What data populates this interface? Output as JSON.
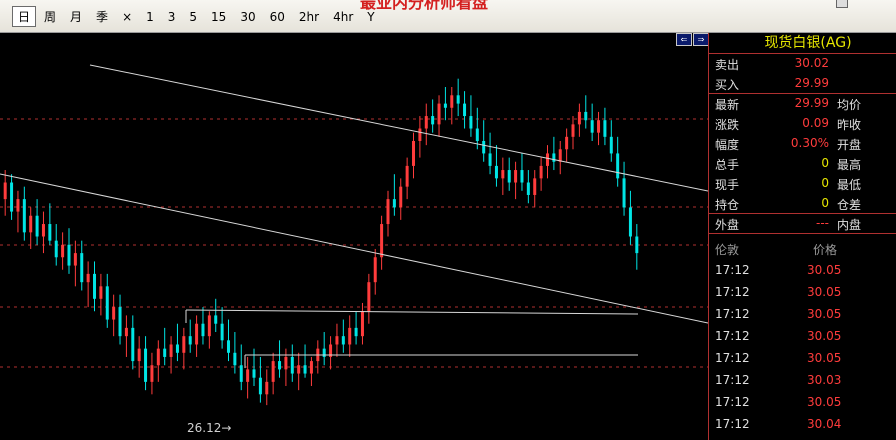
{
  "toolbar": {
    "periods": [
      "日",
      "周",
      "月",
      "季",
      "×",
      "1",
      "3",
      "5",
      "15",
      "30",
      "60",
      "2hr",
      "4hr",
      "Y"
    ],
    "active_index": 0,
    "banner": "最业内分析师看盘"
  },
  "chart": {
    "low_label": "26.12→"
  },
  "panel": {
    "title": "现货白银(AG)",
    "quote_rows": [
      {
        "label": "卖出",
        "value": "30.02",
        "value_color": "red",
        "label2": ""
      },
      {
        "label": "买入",
        "value": "29.99",
        "value_color": "red",
        "label2": ""
      },
      {
        "label": "最新",
        "value": "29.99",
        "value_color": "red",
        "label2": "均价"
      },
      {
        "label": "涨跌",
        "value": "0.09",
        "value_color": "red",
        "label2": "昨收"
      },
      {
        "label": "幅度",
        "value": "0.30%",
        "value_color": "red",
        "label2": "开盘"
      },
      {
        "label": "总手",
        "value": "0",
        "value_color": "yellow",
        "label2": "最高"
      },
      {
        "label": "现手",
        "value": "0",
        "value_color": "yellow",
        "label2": "最低"
      },
      {
        "label": "持仓",
        "value": "0",
        "value_color": "yellow",
        "label2": "仓差"
      },
      {
        "label": "外盘",
        "value": "---",
        "value_color": "red",
        "label2": "内盘"
      }
    ],
    "ticks_header": {
      "col1": "伦敦",
      "col2": "价格"
    },
    "ticks": [
      {
        "time": "17:12",
        "price": "30.05"
      },
      {
        "time": "17:12",
        "price": "30.05"
      },
      {
        "time": "17:12",
        "price": "30.05"
      },
      {
        "time": "17:12",
        "price": "30.05"
      },
      {
        "time": "17:12",
        "price": "30.05"
      },
      {
        "time": "17:12",
        "price": "30.03"
      },
      {
        "time": "17:12",
        "price": "30.05"
      },
      {
        "time": "17:12",
        "price": "30.04"
      }
    ]
  },
  "chart_data": {
    "type": "candlestick",
    "price_low_marker": 26.12,
    "colors": {
      "up": "#ff3c3c",
      "down": "#00e5e5",
      "background": "#000000",
      "grid": "#b03030"
    },
    "grid": "dashed horizontal",
    "series": [
      {
        "ohlc": [
          [
            28.6,
            28.95,
            28.4,
            28.8
          ],
          [
            28.8,
            28.9,
            28.35,
            28.45
          ],
          [
            28.45,
            28.7,
            28.2,
            28.6
          ],
          [
            28.6,
            28.75,
            28.1,
            28.2
          ],
          [
            28.2,
            28.5,
            28.0,
            28.4
          ],
          [
            28.4,
            28.6,
            28.05,
            28.15
          ],
          [
            28.15,
            28.45,
            27.95,
            28.3
          ],
          [
            28.3,
            28.55,
            28.05,
            28.1
          ],
          [
            28.1,
            28.3,
            27.8,
            27.9
          ],
          [
            27.9,
            28.2,
            27.75,
            28.05
          ],
          [
            28.05,
            28.25,
            27.7,
            27.8
          ],
          [
            27.8,
            28.1,
            27.55,
            27.95
          ],
          [
            27.95,
            28.1,
            27.5,
            27.6
          ],
          [
            27.6,
            27.85,
            27.3,
            27.7
          ],
          [
            27.7,
            27.85,
            27.25,
            27.4
          ],
          [
            27.4,
            27.7,
            27.2,
            27.55
          ],
          [
            27.55,
            27.7,
            27.05,
            27.15
          ],
          [
            27.15,
            27.45,
            26.95,
            27.3
          ],
          [
            27.3,
            27.45,
            26.85,
            26.95
          ],
          [
            26.95,
            27.2,
            26.7,
            27.05
          ],
          [
            27.05,
            27.2,
            26.55,
            26.65
          ],
          [
            26.65,
            26.95,
            26.45,
            26.8
          ],
          [
            26.8,
            26.95,
            26.3,
            26.4
          ],
          [
            26.4,
            26.75,
            26.25,
            26.6
          ],
          [
            26.6,
            26.9,
            26.4,
            26.8
          ],
          [
            26.8,
            27.05,
            26.6,
            26.7
          ],
          [
            26.7,
            26.95,
            26.5,
            26.85
          ],
          [
            26.85,
            27.1,
            26.65,
            26.75
          ],
          [
            26.75,
            27.05,
            26.55,
            26.95
          ],
          [
            26.95,
            27.15,
            26.75,
            26.85
          ],
          [
            26.85,
            27.2,
            26.7,
            27.1
          ],
          [
            27.1,
            27.3,
            26.85,
            26.95
          ],
          [
            26.95,
            27.25,
            26.8,
            27.2
          ],
          [
            27.2,
            27.4,
            27.0,
            27.1
          ],
          [
            27.1,
            27.3,
            26.8,
            26.9
          ],
          [
            26.9,
            27.15,
            26.65,
            26.75
          ],
          [
            26.75,
            27.0,
            26.5,
            26.6
          ],
          [
            26.6,
            26.85,
            26.3,
            26.4
          ],
          [
            26.4,
            26.7,
            26.2,
            26.55
          ],
          [
            26.55,
            26.8,
            26.35,
            26.45
          ],
          [
            26.45,
            26.7,
            26.15,
            26.25
          ],
          [
            26.25,
            26.55,
            26.12,
            26.4
          ],
          [
            26.4,
            26.75,
            26.25,
            26.65
          ],
          [
            26.65,
            26.9,
            26.45,
            26.55
          ],
          [
            26.55,
            26.8,
            26.35,
            26.7
          ],
          [
            26.7,
            26.85,
            26.4,
            26.5
          ],
          [
            26.5,
            26.75,
            26.3,
            26.6
          ],
          [
            26.6,
            26.85,
            26.45,
            26.5
          ],
          [
            26.5,
            26.7,
            26.35,
            26.65
          ],
          [
            26.65,
            26.9,
            26.5,
            26.8
          ],
          [
            26.8,
            27.0,
            26.6,
            26.7
          ],
          [
            26.7,
            26.95,
            26.55,
            26.85
          ],
          [
            26.85,
            27.1,
            26.7,
            26.95
          ],
          [
            26.95,
            27.15,
            26.75,
            26.85
          ],
          [
            26.85,
            27.2,
            26.7,
            27.05
          ],
          [
            27.05,
            27.25,
            26.85,
            26.95
          ],
          [
            26.95,
            27.35,
            26.85,
            27.25
          ],
          [
            27.25,
            27.7,
            27.1,
            27.6
          ],
          [
            27.6,
            28.0,
            27.45,
            27.9
          ],
          [
            27.9,
            28.4,
            27.75,
            28.3
          ],
          [
            28.3,
            28.7,
            28.15,
            28.6
          ],
          [
            28.6,
            28.9,
            28.4,
            28.5
          ],
          [
            28.5,
            28.85,
            28.35,
            28.75
          ],
          [
            28.75,
            29.1,
            28.6,
            29.0
          ],
          [
            29.0,
            29.4,
            28.85,
            29.3
          ],
          [
            29.3,
            29.6,
            29.1,
            29.45
          ],
          [
            29.45,
            29.75,
            29.25,
            29.6
          ],
          [
            29.6,
            29.8,
            29.4,
            29.5
          ],
          [
            29.5,
            29.85,
            29.35,
            29.75
          ],
          [
            29.75,
            29.95,
            29.55,
            29.7
          ],
          [
            29.7,
            29.95,
            29.5,
            29.85
          ],
          [
            29.85,
            30.05,
            29.6,
            29.75
          ],
          [
            29.75,
            29.9,
            29.45,
            29.6
          ],
          [
            29.6,
            29.85,
            29.35,
            29.45
          ],
          [
            29.45,
            29.7,
            29.2,
            29.3
          ],
          [
            29.3,
            29.55,
            29.05,
            29.15
          ],
          [
            29.15,
            29.4,
            28.9,
            29.0
          ],
          [
            29.0,
            29.25,
            28.75,
            28.85
          ],
          [
            28.85,
            29.1,
            28.65,
            28.95
          ],
          [
            28.95,
            29.1,
            28.7,
            28.8
          ],
          [
            28.8,
            29.05,
            28.6,
            28.95
          ],
          [
            28.95,
            29.15,
            28.7,
            28.8
          ],
          [
            28.8,
            28.95,
            28.55,
            28.65
          ],
          [
            28.65,
            28.95,
            28.5,
            28.85
          ],
          [
            28.85,
            29.1,
            28.7,
            29.0
          ],
          [
            29.0,
            29.25,
            28.85,
            29.15
          ],
          [
            29.15,
            29.35,
            28.95,
            29.05
          ],
          [
            29.05,
            29.3,
            28.9,
            29.2
          ],
          [
            29.2,
            29.45,
            29.05,
            29.35
          ],
          [
            29.35,
            29.6,
            29.2,
            29.5
          ],
          [
            29.5,
            29.75,
            29.35,
            29.65
          ],
          [
            29.65,
            29.85,
            29.45,
            29.55
          ],
          [
            29.55,
            29.75,
            29.3,
            29.4
          ],
          [
            29.4,
            29.65,
            29.25,
            29.55
          ],
          [
            29.55,
            29.7,
            29.25,
            29.35
          ],
          [
            29.35,
            29.55,
            29.05,
            29.15
          ],
          [
            29.15,
            29.35,
            28.75,
            28.85
          ],
          [
            28.85,
            29.05,
            28.4,
            28.5
          ],
          [
            28.5,
            28.7,
            28.05,
            28.15
          ],
          [
            28.15,
            28.3,
            27.75,
            27.95
          ]
        ]
      }
    ]
  }
}
